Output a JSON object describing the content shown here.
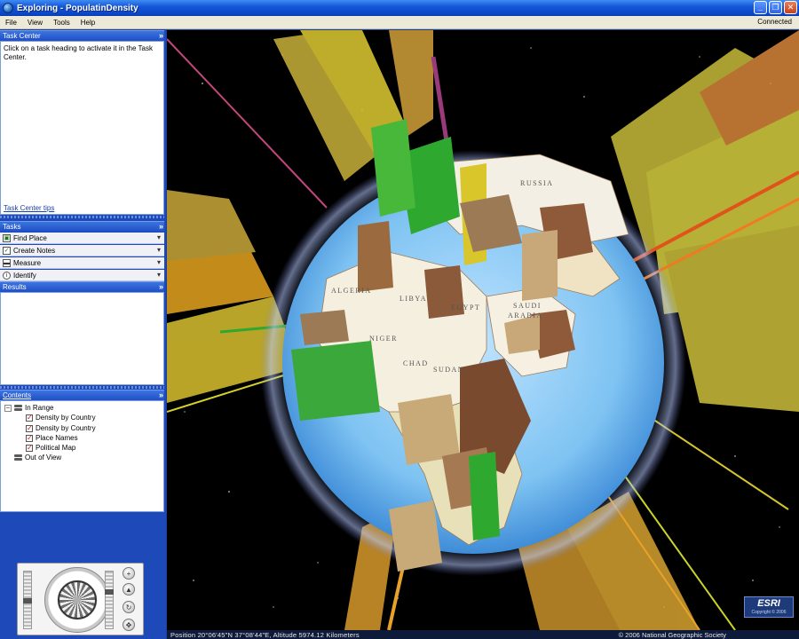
{
  "window": {
    "title": "Exploring - PopulatinDensity"
  },
  "menu": {
    "items": [
      "File",
      "View",
      "Tools",
      "Help"
    ],
    "status": "Connected"
  },
  "task_center": {
    "header": "Task Center",
    "text": "Click on a task heading to activate it in the Task Center.",
    "link": "Task Center tips"
  },
  "tasks": {
    "header": "Tasks",
    "items": [
      {
        "label": "Find Place",
        "icon": "find-place-icon"
      },
      {
        "label": "Create Notes",
        "icon": "notes-icon"
      },
      {
        "label": "Measure",
        "icon": "measure-icon"
      },
      {
        "label": "Identify",
        "icon": "identify-icon"
      }
    ]
  },
  "results": {
    "header": "Results"
  },
  "contents": {
    "header": "Contents",
    "in_range": "In Range",
    "layers": [
      "Density by Country",
      "Density by Country",
      "Place Names",
      "Political Map"
    ],
    "out_of_view": "Out of View"
  },
  "globe_labels": [
    "RUSSIA",
    "SAUDI",
    "ARABIA",
    "NIGER",
    "CHAD",
    "SUDAN",
    "ALGERIA",
    "LIBYA",
    "EGYPT"
  ],
  "statusbar": {
    "position": "Position  20°06'45\"N  37°08'44\"E, Altitude  5974.12 Kilometers",
    "copyright": "© 2006 National Geographic Society"
  },
  "logo": {
    "name": "ESRI",
    "sub": "Copyright © 2006"
  },
  "colors": {
    "titlebar": "#1557d9",
    "panel": "#1e49b8",
    "space": "#000000"
  }
}
